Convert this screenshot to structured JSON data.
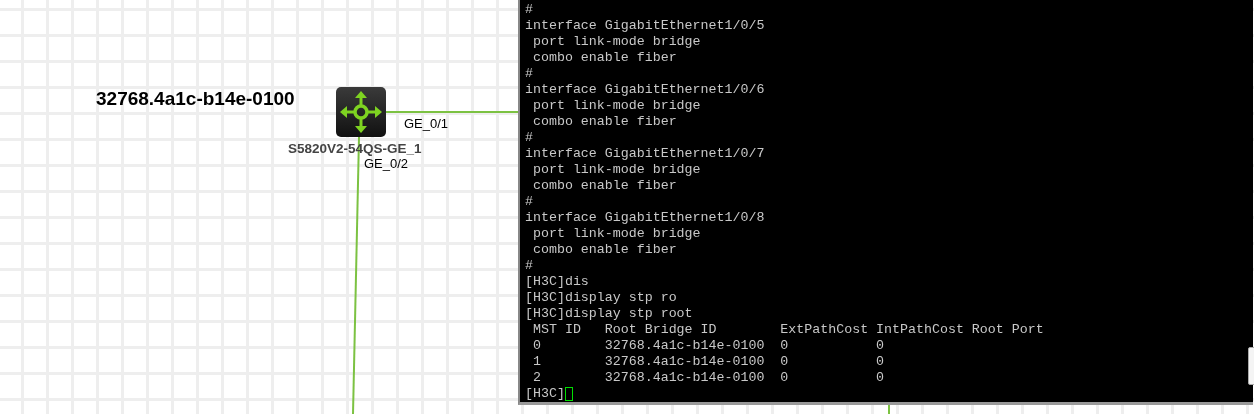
{
  "topology": {
    "root_bridge_label": "32768.4a1c-b14e-0100",
    "device": {
      "name": "S5820V2-54QS-GE_1"
    },
    "ports": [
      {
        "label": "GE_0/1"
      },
      {
        "label": "GE_0/2"
      }
    ]
  },
  "terminal": {
    "lines": [
      "#",
      "interface GigabitEthernet1/0/5",
      " port link-mode bridge",
      " combo enable fiber",
      "#",
      "interface GigabitEthernet1/0/6",
      " port link-mode bridge",
      " combo enable fiber",
      "#",
      "interface GigabitEthernet1/0/7",
      " port link-mode bridge",
      " combo enable fiber",
      "#",
      "interface GigabitEthernet1/0/8",
      " port link-mode bridge",
      " combo enable fiber",
      "#",
      "[H3C]dis",
      "[H3C]display stp ro",
      "[H3C]display stp root",
      " MST ID   Root Bridge ID        ExtPathCost IntPathCost Root Port",
      " 0        32768.4a1c-b14e-0100  0           0",
      " 1        32768.4a1c-b14e-0100  0           0",
      " 2        32768.4a1c-b14e-0100  0           0"
    ],
    "prompt": "[H3C]"
  }
}
